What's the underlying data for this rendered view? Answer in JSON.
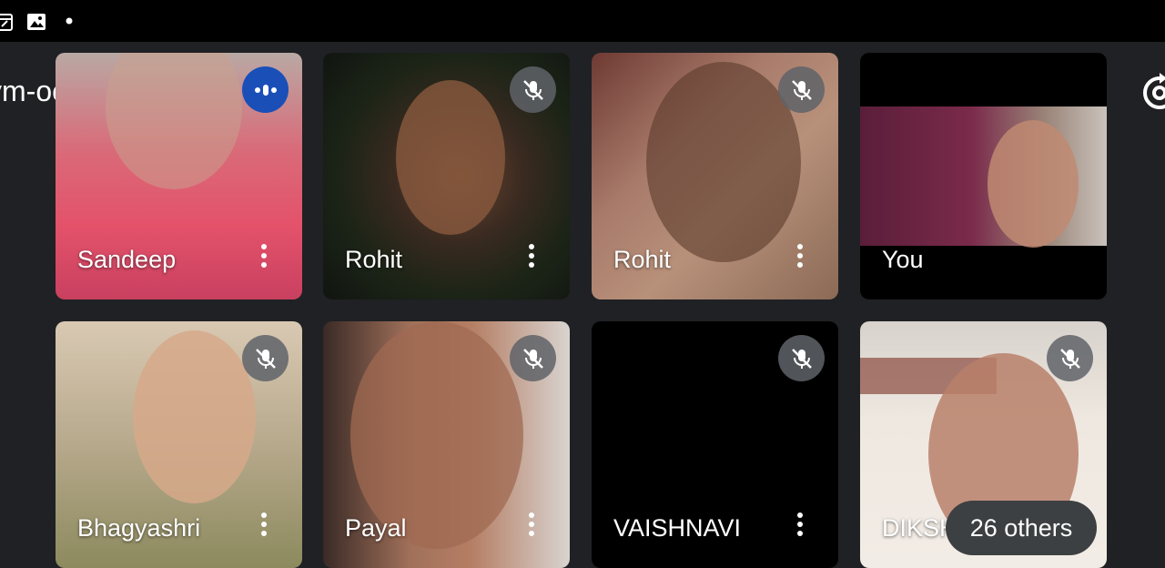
{
  "status_bar": {
    "icons": [
      "calendar-icon",
      "image-icon",
      "dot-icon"
    ]
  },
  "meeting": {
    "code": "ym-ocqd-zcn"
  },
  "participants": [
    {
      "name": "Sandeep",
      "state": "speaking"
    },
    {
      "name": "Rohit",
      "state": "muted"
    },
    {
      "name": "Rohit",
      "state": "muted"
    },
    {
      "name": "You",
      "state": "self"
    },
    {
      "name": "Bhagyashri",
      "state": "muted"
    },
    {
      "name": "Payal",
      "state": "muted"
    },
    {
      "name": "VAISHNAVI",
      "state": "muted"
    },
    {
      "name": "DIKSH",
      "state": "muted"
    }
  ],
  "others_label": "26 others",
  "colors": {
    "background": "#202124",
    "speaking": "#1a4fb8",
    "mic_off": "#5f6368"
  }
}
